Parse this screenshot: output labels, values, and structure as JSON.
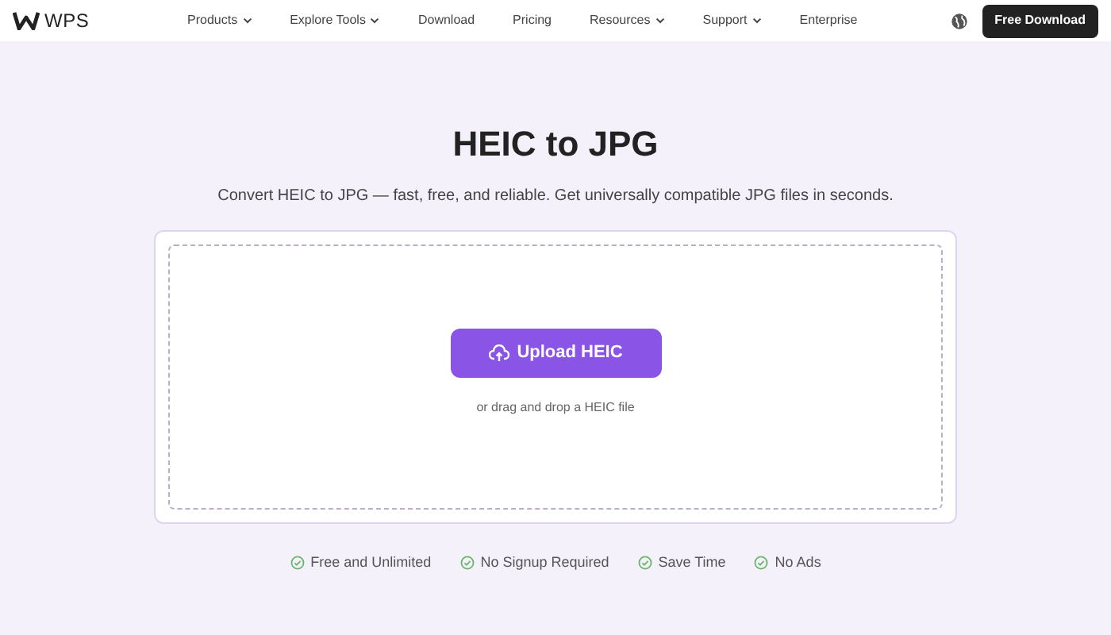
{
  "header": {
    "logo": "WPS",
    "nav": [
      {
        "label": "Products",
        "dropdown": true
      },
      {
        "label": "Explore Tools",
        "dropdown": true
      },
      {
        "label": "Download",
        "dropdown": false
      },
      {
        "label": "Pricing",
        "dropdown": false
      },
      {
        "label": "Resources",
        "dropdown": true
      },
      {
        "label": "Support",
        "dropdown": true
      },
      {
        "label": "Enterprise",
        "dropdown": false
      }
    ],
    "cta": "Free Download"
  },
  "title": "HEIC to JPG",
  "subtitle": "Convert HEIC to JPG — fast, free, and reliable. Get universally compatible JPG files in seconds.",
  "upload": {
    "button": "Upload HEIC",
    "hint": "or drag and drop a HEIC file"
  },
  "features": [
    "Free and Unlimited",
    "No Signup Required",
    "Save Time",
    "No Ads"
  ]
}
